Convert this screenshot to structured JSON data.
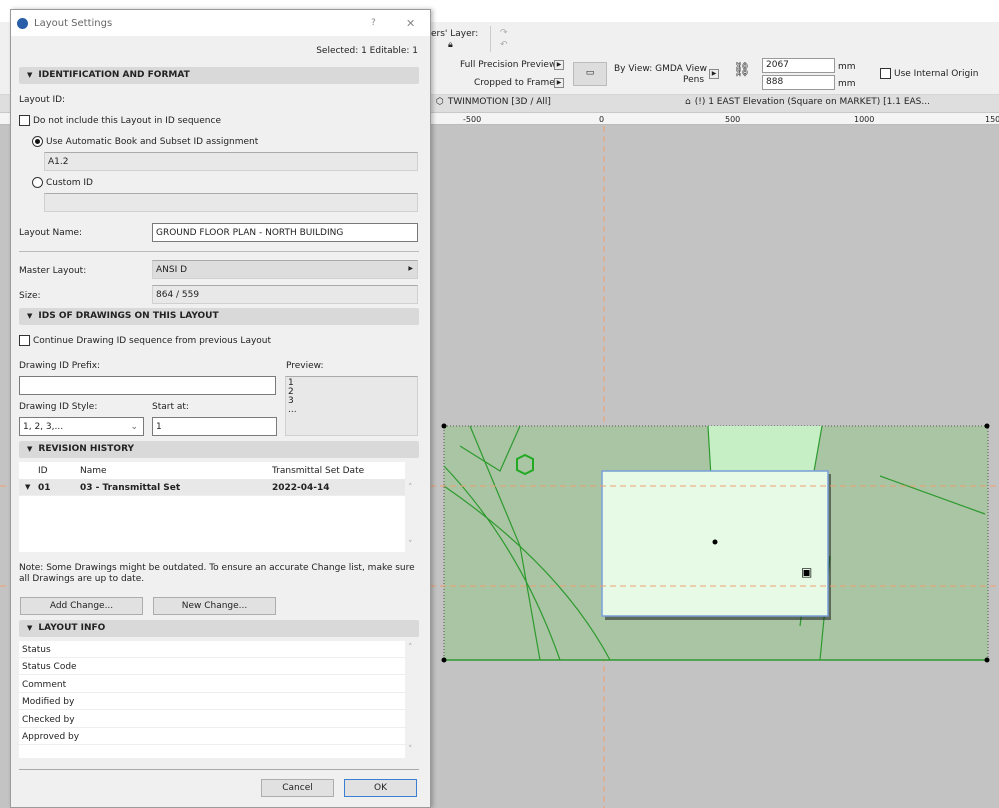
{
  "toolbar": {
    "layer_label": "ers' Layer:",
    "preview_mode": "Full Precision Preview",
    "crop_mode": "Cropped to Frame",
    "pens_label": "By View: GMDA View",
    "pens_label2": "Pens",
    "width_value": "2067",
    "height_value": "888",
    "unit": "mm",
    "use_internal_origin": "Use Internal Origin",
    "use_internal_origin_checked": false
  },
  "tabs": [
    {
      "label": "TWINMOTION [3D / All]",
      "icon": "cube-icon"
    },
    {
      "label": "(!) 1 EAST Elevation (Square on MARKET) [1.1 EAS...",
      "icon": "elevation-icon"
    }
  ],
  "ruler": {
    "ticks": [
      "-500",
      "0",
      "500",
      "1000",
      "150"
    ]
  },
  "dialog": {
    "title": "Layout Settings",
    "help": "?",
    "close": "✕",
    "selected_info": "Selected: 1 Editable: 1",
    "sections": {
      "identification": "IDENTIFICATION AND FORMAT",
      "drawing_ids": "IDS OF DRAWINGS ON THIS LAYOUT",
      "revision_history": "REVISION HISTORY",
      "layout_info": "LAYOUT INFO"
    },
    "layout_id_label": "Layout ID:",
    "exclude_from_sequence": "Do not include this Layout in ID sequence",
    "exclude_checked": false,
    "auto_id_option": "Use Automatic Book and Subset ID assignment",
    "auto_id_value": "A1.2",
    "custom_id_option": "Custom ID",
    "custom_id_value": "",
    "selected_id_mode": "automatic",
    "layout_name_label": "Layout Name:",
    "layout_name_value": "GROUND FLOOR PLAN - NORTH BUILDING",
    "master_layout_label": "Master Layout:",
    "master_layout_value": "ANSI D",
    "size_label": "Size:",
    "size_value": "864 / 559",
    "continue_sequence": "Continue Drawing ID sequence from previous Layout",
    "continue_checked": false,
    "prefix_label": "Drawing ID Prefix:",
    "prefix_value": "",
    "preview_label": "Preview:",
    "preview_lines": [
      "1",
      "2",
      "3",
      "..."
    ],
    "style_label": "Drawing ID Style:",
    "style_value": "1, 2, 3,...",
    "start_label": "Start at:",
    "start_value": "1",
    "revision_columns": [
      "ID",
      "Name",
      "Transmittal Set Date"
    ],
    "revision_rows": [
      {
        "id": "01",
        "name": "03 - Transmittal Set",
        "date": "2022-04-14"
      }
    ],
    "note": "Note: Some Drawings might be outdated. To ensure an accurate Change list, make sure all Drawings are up to date.",
    "add_change": "Add Change...",
    "new_change": "New Change...",
    "layout_info_rows": [
      "Status",
      "Status Code",
      "Comment",
      "Modified by",
      "Checked by",
      "Approved by"
    ],
    "cancel": "Cancel",
    "ok": "OK"
  }
}
